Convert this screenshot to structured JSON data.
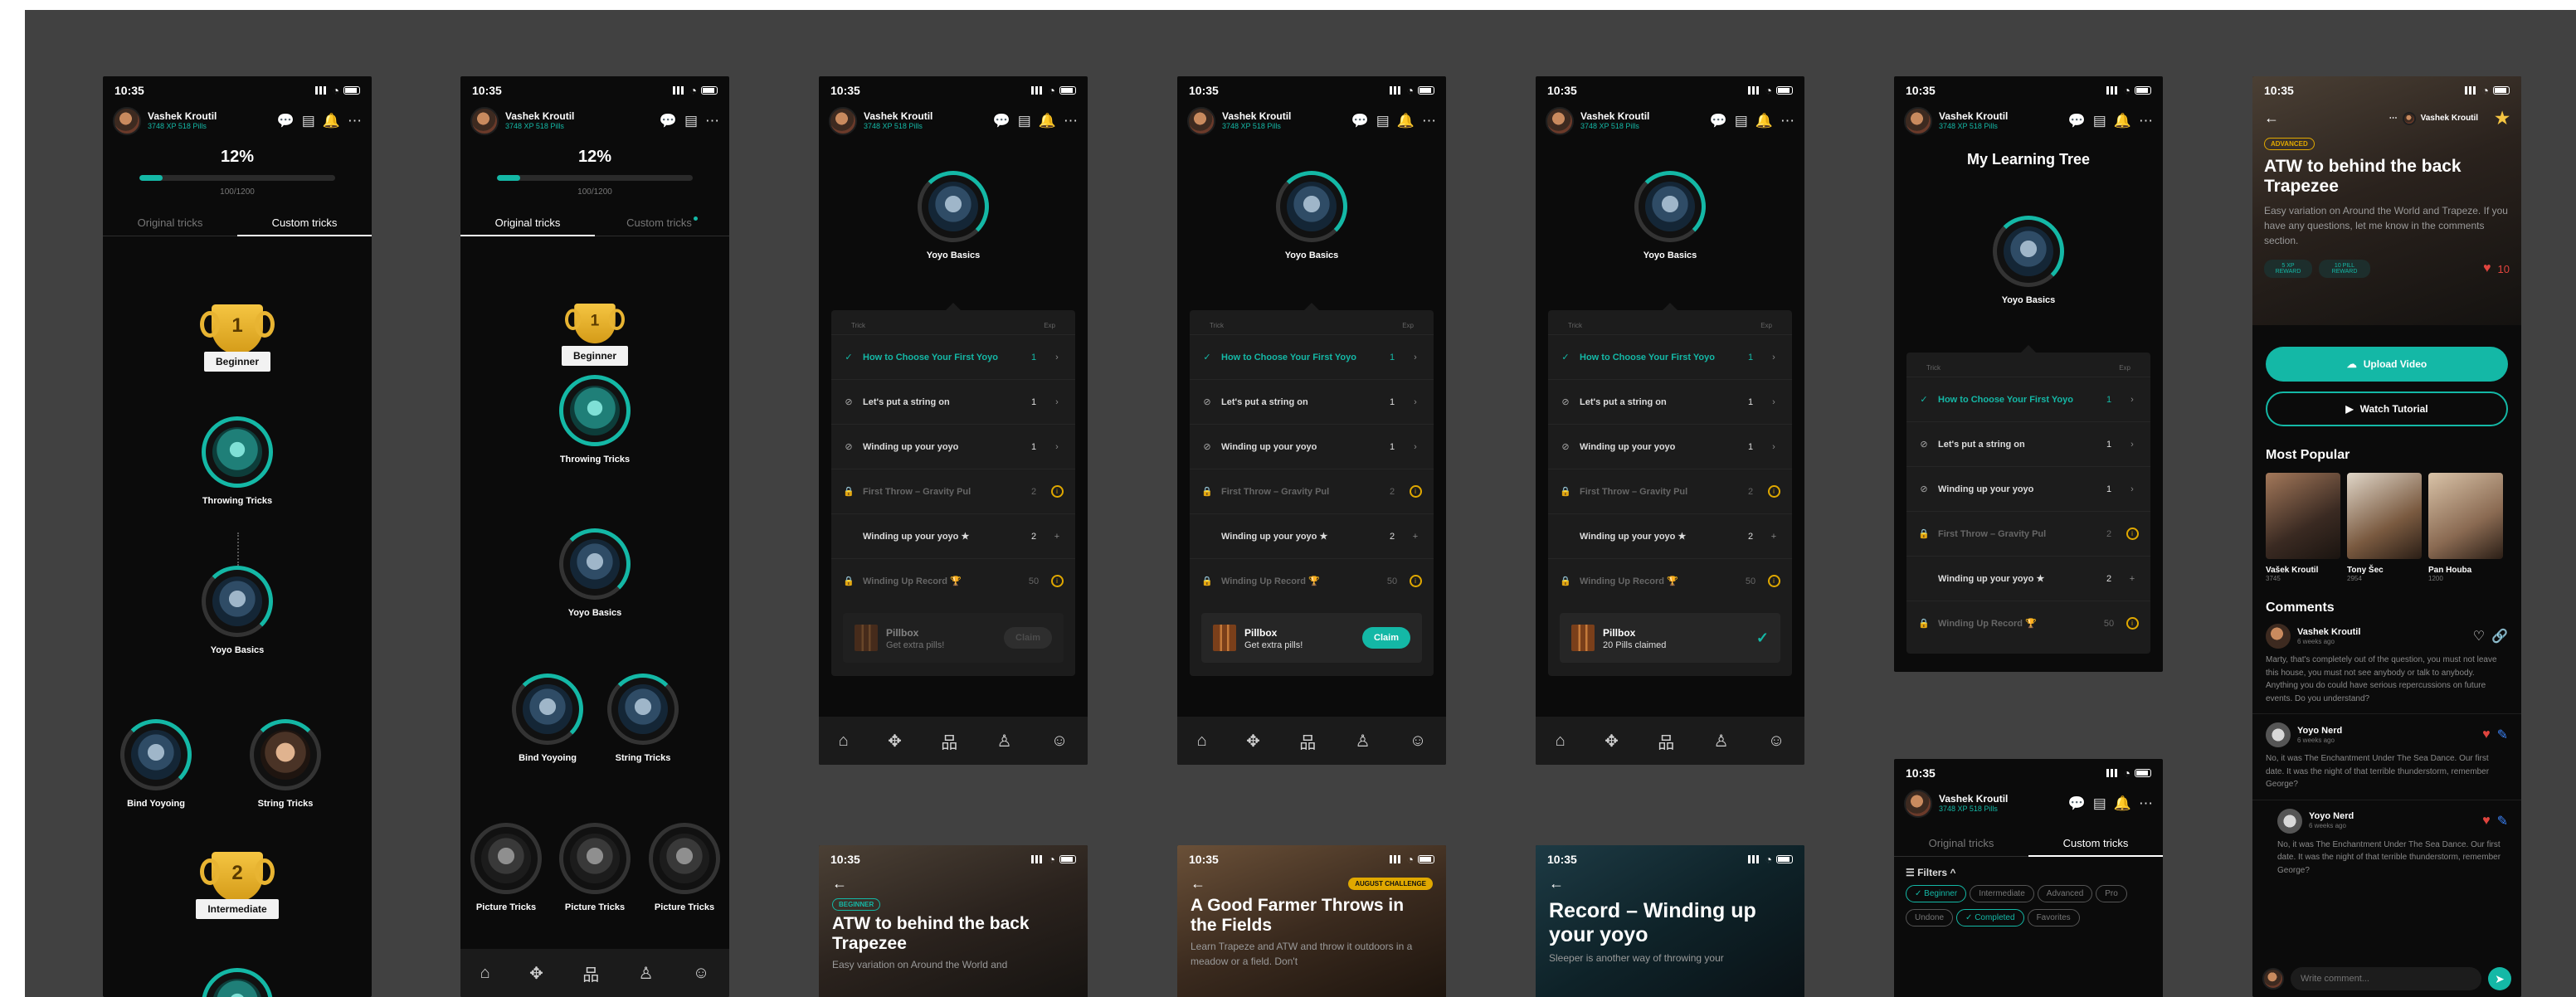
{
  "status_time": "10:35",
  "user": {
    "name": "Vashek Kroutil",
    "stats": "3748 XP  518 Pills"
  },
  "progress": {
    "percent_text": "12%",
    "fraction": 0.12,
    "count": "100/1200"
  },
  "tabs": {
    "original": "Original tricks",
    "custom": "Custom tricks"
  },
  "tree1": {
    "trophy1": {
      "number": "1",
      "label": "Beginner"
    },
    "trophy2": {
      "number": "2",
      "label": "Intermediate"
    },
    "nodes": [
      "Throwing Tricks",
      "Yoyo Basics",
      "Bind Yoyoing",
      "String Tricks"
    ]
  },
  "tree2": {
    "trophy1": {
      "number": "1",
      "label": "Beginner"
    },
    "nodes": [
      "Throwing Tricks",
      "Yoyo Basics",
      "Bind Yoyoing",
      "String Tricks",
      "Picture Tricks",
      "Picture Tricks",
      "Picture Tricks"
    ]
  },
  "basics_title": "Yoyo Basics",
  "learning_tree_title": "My Learning Tree",
  "table_head": {
    "trick": "Trick",
    "exp": "Exp"
  },
  "tricks": [
    {
      "name": "How to Choose Your First Yoyo",
      "xp": "1",
      "state": "done"
    },
    {
      "name": "Let's put a string on",
      "xp": "1",
      "state": "open"
    },
    {
      "name": "Winding up your yoyo",
      "xp": "1",
      "state": "open"
    },
    {
      "name": "First Throw – Gravity Pul",
      "xp": "2",
      "state": "locked"
    },
    {
      "name": "Winding up your yoyo ★",
      "xp": "2",
      "state": "plus"
    },
    {
      "name": "Winding Up Record 🏆",
      "xp": "50",
      "state": "locked"
    }
  ],
  "pillbox": {
    "title": "Pillbox",
    "sub_locked": "Get extra pills!",
    "sub_ready": "Get extra pills!",
    "sub_claimed": "20 Pills claimed",
    "claim": "Claim"
  },
  "detail": {
    "tag": "ADVANCED",
    "title": "ATW to behind the back Trapezee",
    "desc": "Easy variation on Around the World and Trapeze. If you have any questions, let me know in the comments section.",
    "reward1": "5 XP REWARD",
    "reward2": "10 PILL REWARD",
    "likes": "10",
    "upload": "Upload Video",
    "watch": "Watch Tutorial",
    "popular_title": "Most Popular",
    "popular": [
      {
        "name": "Vašek Kroutil",
        "sub": "3745"
      },
      {
        "name": "Tony Šec",
        "sub": "2954"
      },
      {
        "name": "Pan Houba",
        "sub": "1200"
      }
    ],
    "comments_title": "Comments",
    "comments": [
      {
        "name": "Vashek Kroutil",
        "time": "6 weeks ago",
        "text": "Marty, that's completely out of the question, you must not leave this house, you must not see anybody or talk to anybody. Anything you do could have serious repercussions on future events. Do you understand?"
      },
      {
        "name": "Yoyo Nerd",
        "time": "6 weeks ago",
        "text": "No, it was The Enchantment Under The Sea Dance. Our first date. It was the night of that terrible thunderstorm, remember George?"
      },
      {
        "name": "Yoyo Nerd",
        "time": "6 weeks ago",
        "text": "No, it was The Enchantment Under The Sea Dance. Our first date. It was the night of that terrible thunderstorm, remember George?"
      }
    ],
    "write_placeholder": "Write comment..."
  },
  "bottom_cards": [
    {
      "tag": "BEGINNER",
      "title": "ATW to behind the back Trapezee",
      "desc": "Easy variation on Around the World and"
    },
    {
      "tag": "AUGUST CHALLENGE",
      "title": "A Good Farmer Throws in the Fields",
      "desc": "Learn Trapeze and ATW and throw it outdoors in a meadow or a field. Don't"
    },
    {
      "tag": "",
      "title": "Record – Winding up your yoyo",
      "desc": "Sleeper is another way of throwing your"
    }
  ],
  "filters": {
    "title": "Filters",
    "chips": [
      {
        "label": "✓ Beginner",
        "on": true
      },
      {
        "label": "Intermediate",
        "on": false
      },
      {
        "label": "Advanced",
        "on": false
      },
      {
        "label": "Pro",
        "on": false
      },
      {
        "label": "Undone",
        "on": false
      },
      {
        "label": "✓ Completed",
        "on": true
      },
      {
        "label": "Favorites",
        "on": false
      }
    ]
  },
  "icons": [
    "chat-icon",
    "shop-icon",
    "bell-icon",
    "more-icon",
    "home-icon",
    "tricks-icon",
    "tree-icon",
    "leaderboard-icon",
    "profile-icon"
  ],
  "colors": {
    "accent": "#14b8a6",
    "warning": "#e0a800",
    "gold": "#f5c542",
    "board": "#414141",
    "screen": "#0b0b0b"
  }
}
